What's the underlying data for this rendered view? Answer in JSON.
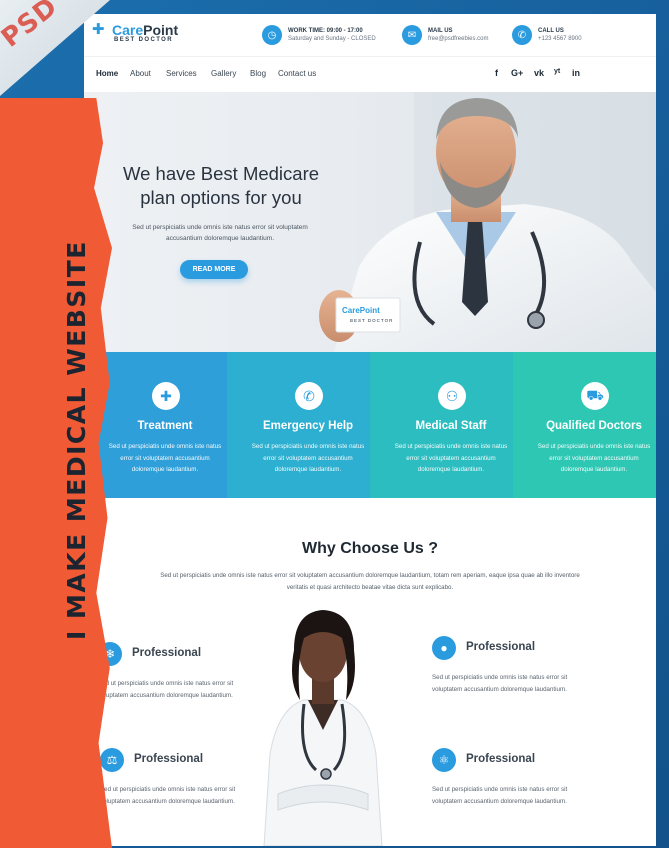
{
  "watermark": {
    "text": "PSD"
  },
  "banner": {
    "text": "I MAKE MEDICAL WEBSITE"
  },
  "header": {
    "logo_name_part1": "Care",
    "logo_name_part2": "Point",
    "logo_sub": "BEST DOCTOR",
    "work_title": "WORK TIME: 09:00 - 17:00",
    "work_sub": "Saturday and Sunday - CLOSED",
    "mail_title": "MAIL US",
    "mail_sub": "free@psdfreebies.com",
    "call_title": "CALL US",
    "call_sub": "+123 4567 8900"
  },
  "nav": {
    "items": [
      "Home",
      "About",
      "Services",
      "Gallery",
      "Blog",
      "Contact us"
    ],
    "social": [
      "f",
      "G+",
      "vk",
      "yt",
      "in"
    ]
  },
  "hero": {
    "title_line1": "We have Best Medicare",
    "title_line2": "plan options for you",
    "desc": "Sed ut perspiciatis unde omnis iste natus error sit voluptatem accusantium doloremque laudantium.",
    "button": "READ MORE",
    "card_logo": "CarePoint",
    "card_sub": "BEST DOCTOR"
  },
  "features": [
    {
      "title": "Treatment",
      "desc": "Sed ut perspiciatis unde omnis iste natus error sit voluptatem accusantium doloremque laudantium.",
      "color": "#2f9fd9"
    },
    {
      "title": "Emergency Help",
      "desc": "Sed ut perspiciatis unde omnis iste natus error sit voluptatem accusantium doloremque laudantium.",
      "color": "#2cafd0"
    },
    {
      "title": "Medical Staff",
      "desc": "Sed ut perspiciatis unde omnis iste natus error sit voluptatem accusantium doloremque laudantium.",
      "color": "#2cbdc0"
    },
    {
      "title": "Qualified Doctors",
      "desc": "Sed ut perspiciatis unde omnis iste natus error sit voluptatem accusantium doloremque laudantium.",
      "color": "#2dc7b3"
    }
  ],
  "why": {
    "title": "Why Choose Us ?",
    "desc": "Sed ut perspiciatis unde omnis iste natus error sit voluptatem accusantium doloremque laudantium, totam rem aperiam, eaque ipsa quae ab illo inventore veritatis et quasi architecto beatae vitae dicta sunt explicabo.",
    "items": [
      {
        "title": "Professional",
        "desc": "Sed ut perspiciatis unde omnis iste natus error sit voluptatem accusantium doloremque laudantium.",
        "icon": "snowflake-icon"
      },
      {
        "title": "Professional",
        "desc": "Sed ut perspiciatis unde omnis iste natus error sit voluptatem accusantium doloremque laudantium.",
        "icon": "pill-icon"
      },
      {
        "title": "Professional",
        "desc": "Sed ut perspiciatis unde omnis iste natus error sit voluptatem accusantium doloremque laudantium.",
        "icon": "microscope-icon"
      },
      {
        "title": "Professional",
        "desc": "Sed ut perspiciatis unde omnis iste natus error sit voluptatem accusantium doloremque laudantium.",
        "icon": "atom-icon"
      }
    ]
  },
  "colors": {
    "accent": "#2b9be0",
    "banner": "#f05a35",
    "frame": "#175f9a",
    "heading": "#1e2933"
  }
}
